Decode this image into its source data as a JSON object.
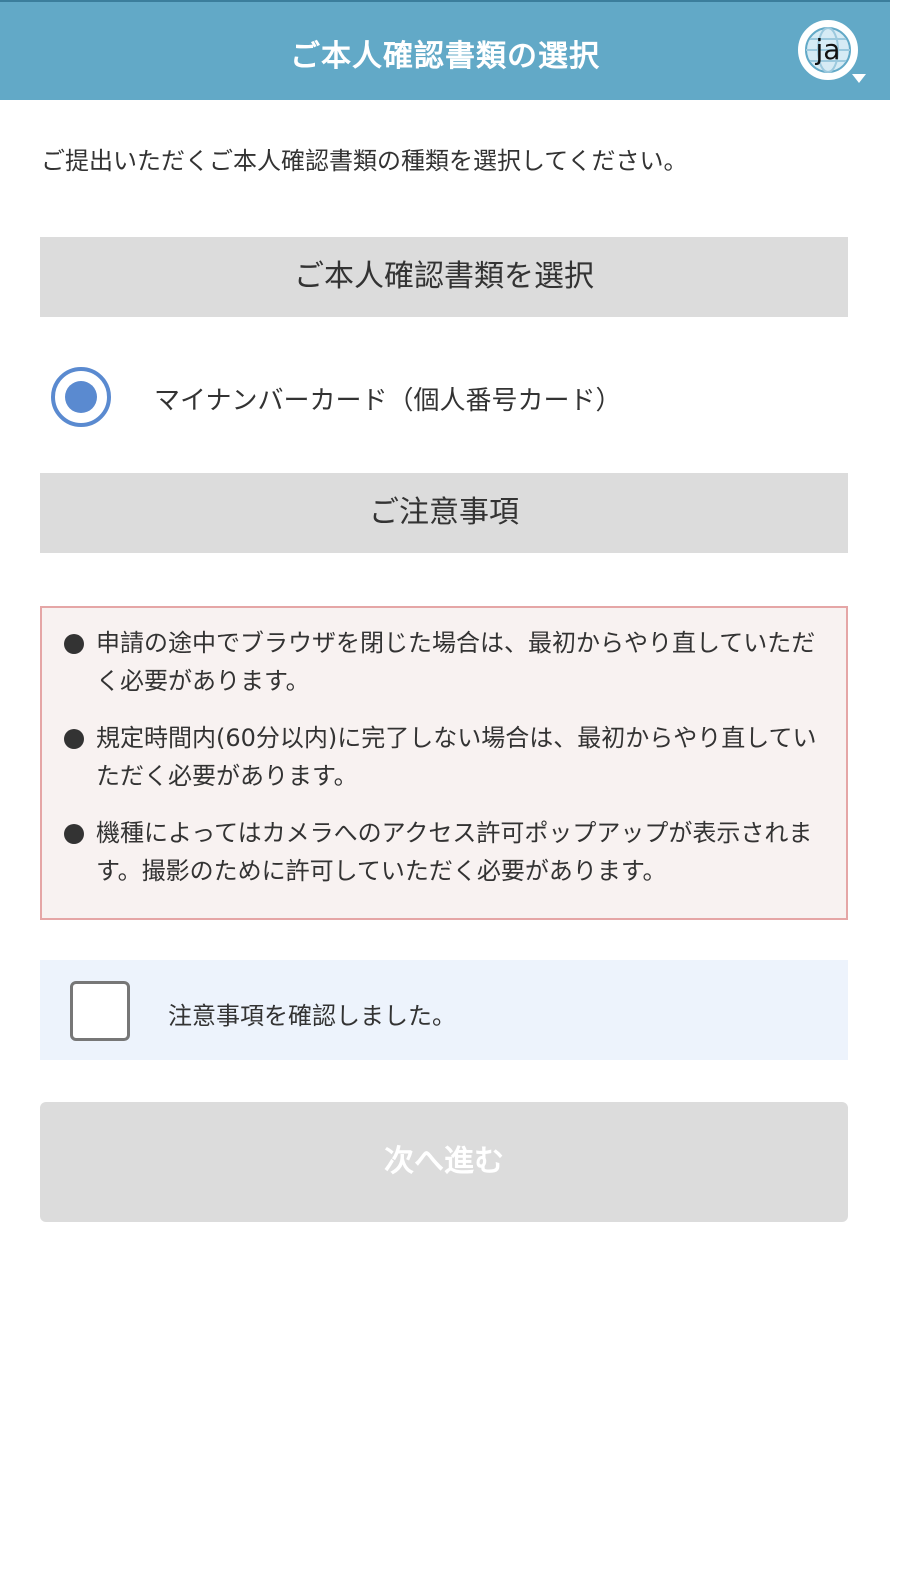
{
  "header": {
    "title": "ご本人確認書類の選択",
    "language_label": "ja",
    "language_icon": "globe-icon",
    "background_color": "#62a9c7"
  },
  "intro_text": "ご提出いただくご本人確認書類の種類を選択してください。",
  "document_section": {
    "heading": "ご本人確認書類を選択",
    "options": [
      {
        "label": "マイナンバーカード（個人番号カード）",
        "selected": true
      }
    ]
  },
  "notes_section": {
    "heading": "ご注意事項",
    "items": [
      "申請の途中でブラウザを閉じた場合は、最初からやり直していただく必要があります。",
      "規定時間内(60分以内)に完了しない場合は、最初からやり直していただく必要があります。",
      "機種によってはカメラへのアクセス許可ポップアップが表示されます。撮影のために許可していただく必要があります。"
    ],
    "background_color": "#f8f2f1",
    "border_color": "#e5a6a6"
  },
  "confirmation": {
    "label": "注意事項を確認しました。",
    "checked": false
  },
  "next_button": {
    "label": "次へ進む",
    "enabled": false
  },
  "colors": {
    "accent": "#5a8ad0",
    "section_background": "#dcdcdc",
    "confirm_background": "#edf3fc"
  }
}
